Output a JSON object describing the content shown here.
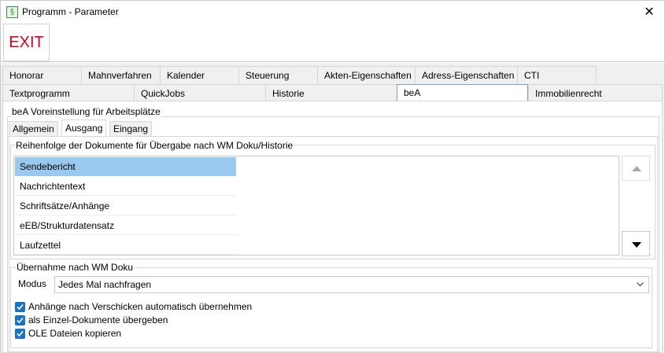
{
  "window": {
    "title": "Programm - Parameter",
    "app_icon_glyph": "§",
    "close_glyph": "✕"
  },
  "toolbar": {
    "exit_label": "EXIT",
    "exit_color": "#d0021b"
  },
  "tabs_row1": [
    "Honorar",
    "Mahnverfahren",
    "Kalender",
    "Steuerung",
    "Akten-Eigenschaften",
    "Adress-Eigenschaften",
    "CTI"
  ],
  "tabs_row2": [
    "Textprogramm",
    "QuickJobs",
    "Historie",
    "beA",
    "Immobilienrecht"
  ],
  "active_tab": "beA",
  "bea": {
    "group_title": "beA Voreinstellung für Arbeitsplätze",
    "subtabs": [
      "Allgemein",
      "Ausgang",
      "Eingang"
    ],
    "active_subtab": "Ausgang",
    "order_group": {
      "title": "Reihenfolge der Dokumente für Übergabe nach WM Doku/Historie",
      "items": [
        "Sendebericht",
        "Nachrichtentext",
        "Schriftsätze/Anhänge",
        "eEB/Strukturdatensatz",
        "Laufzettel"
      ],
      "selected_index": 0,
      "up_icon": "arrow-up-icon",
      "down_icon": "arrow-down-icon"
    },
    "uebernahme_group": {
      "title": "Übernahme nach WM Doku",
      "modus_label": "Modus",
      "modus_value": "Jedes Mal nachfragen",
      "checkboxes": [
        {
          "label": "Anhänge nach Verschicken automatisch übernehmen",
          "checked": true
        },
        {
          "label": "als Einzel-Dokumente übergeben",
          "checked": true
        },
        {
          "label": "OLE Dateien kopieren",
          "checked": true
        }
      ]
    }
  },
  "colors": {
    "selection": "#99c9ef",
    "checkbox": "#1a73c8",
    "active_tab_border": "#7a9cc6"
  }
}
